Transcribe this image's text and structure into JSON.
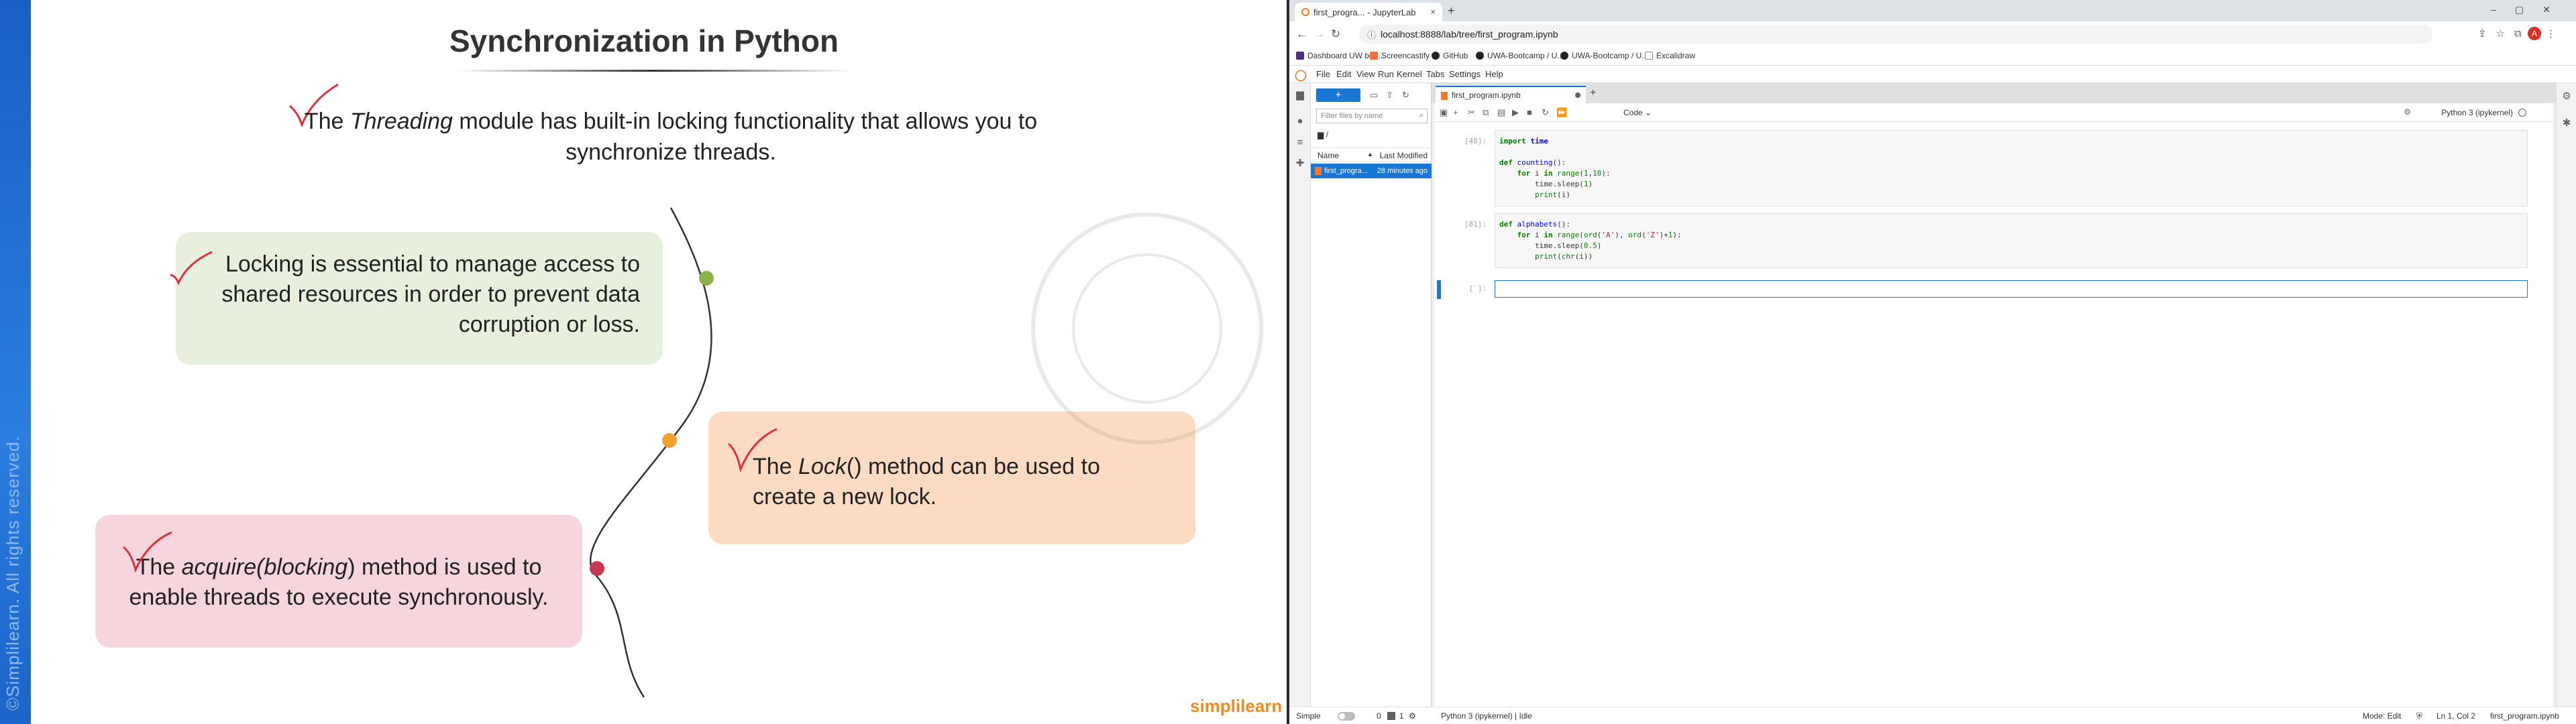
{
  "slide": {
    "title": "Synchronization in Python",
    "intro_pre": "The ",
    "intro_italic": "Threading",
    "intro_post": " module has built-in locking functionality that allows you to synchronize threads.",
    "card_locking": "Locking is essential to manage access to shared resources in order to prevent data corruption or loss.",
    "card_lock_pre": "The ",
    "card_lock_italic": "Lock",
    "card_lock_post": "() method can be used to create a new lock.",
    "card_acquire_pre": "The ",
    "card_acquire_italic": "acquire(blocking",
    "card_acquire_post": ") method is used to enable threads to execute synchronously.",
    "copyright": "©Simplilearn. All rights reserved.",
    "logo": "simplilearn",
    "colors": {
      "accent_green": "#8cb34a",
      "accent_orange": "#f0a030",
      "accent_red": "#c8384e",
      "check_red": "#e03040"
    }
  },
  "browser": {
    "tab_title": "first_progra... - JupyterLab",
    "tab_close": "×",
    "new_tab": "+",
    "url": "localhost:8888/lab/tree/first_program.ipynb",
    "avatar_letter": "A",
    "bookmarks": [
      "Dashboard UW boo...",
      "Screencastify",
      "GitHub",
      "UWA-Bootcamp / U...",
      "UWA-Bootcamp / U...",
      "Excalidraw"
    ]
  },
  "jupyter": {
    "menu": [
      "File",
      "Edit",
      "View",
      "Run",
      "Kernel",
      "Tabs",
      "Settings",
      "Help"
    ],
    "filebrowser": {
      "new_label": "+",
      "filter_placeholder": "Filter files by name",
      "path": "/",
      "col_name": "Name",
      "col_modified": "Last Modified",
      "file_name": "first_progra...",
      "file_modified": "28 minutes ago"
    },
    "notebook_tab": "first_program.ipynb",
    "cell_type": "Code",
    "kernel": "Python 3 (ipykernel)",
    "cells": [
      {
        "prompt": "[48]:"
      },
      {
        "prompt": "[81]:"
      },
      {
        "prompt": "[ ]:"
      }
    ],
    "status": {
      "mode_simple": "Simple",
      "num1": "0",
      "num2": "1",
      "kernel_status": "Python 3 (ipykernel) | Idle",
      "mode": "Mode: Edit",
      "position": "Ln 1, Col 2",
      "file": "first_program.ipynb"
    }
  }
}
